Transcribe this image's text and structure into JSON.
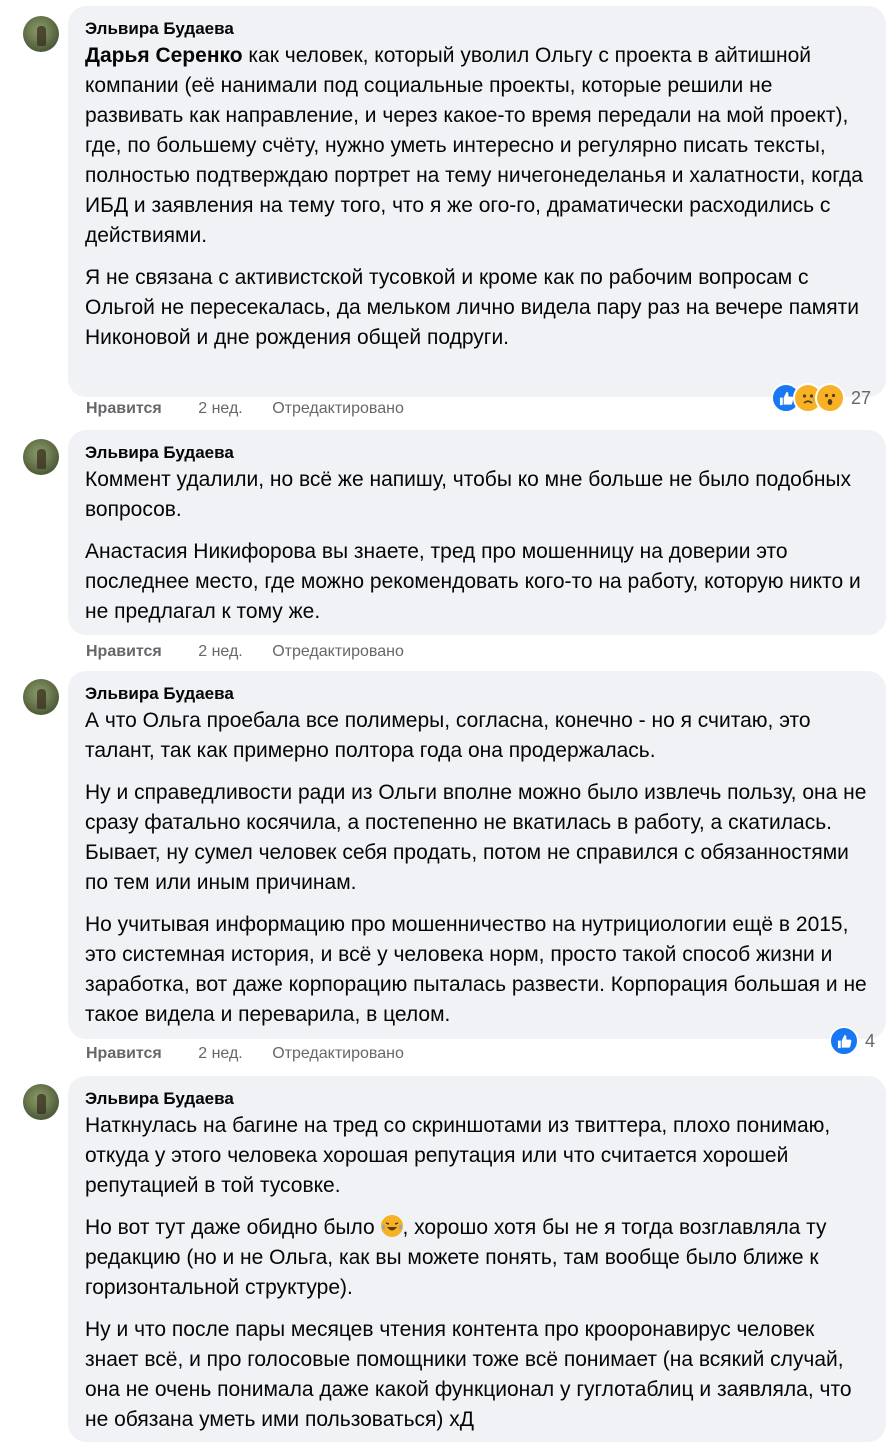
{
  "comments": [
    {
      "author": "Эльвира Будаева",
      "mention": "Дарья Серенко",
      "paragraphs": [
        " как человек, который уволил Ольгу с проекта в айтишной компании (её нанимали под социальные проекты, которые решили не развивать как направление, и через какое-то время передали на мой проект), где, по большему счёту, нужно уметь интересно и регулярно писать тексты, полностью подтверждаю портрет на тему ничегонеделанья и халатности, когда ИБД и заявления на тему того, что я же ого-го, драматически расходились с действиями.",
        "Я не связана с активистской тусовкой и кроме как по рабочим вопросам с Ольгой не пересекалась, да мельком лично видела пару раз на вечере памяти Никоновой и дне рождения общей подруги."
      ],
      "like_label": "Нравится",
      "time": "2 нед.",
      "edited": "Отредактировано",
      "reaction_icons": [
        "like-icon",
        "sad-icon",
        "wow-icon"
      ],
      "reaction_count": "27"
    },
    {
      "author": "Эльвира Будаева",
      "paragraphs": [
        "Коммент удалили, но всё же напишу, чтобы ко мне больше не было подобных вопросов.",
        "Анастасия Никифорова вы знаете, тред про мошенницу на доверии это последнее место, где можно рекомендовать кого-то на работу, которую никто и не предлагал к тому же."
      ],
      "like_label": "Нравится",
      "time": "2 нед.",
      "edited": "Отредактировано"
    },
    {
      "author": "Эльвира Будаева",
      "paragraphs": [
        "А что Ольга проебала все полимеры, согласна, конечно - но я считаю, это талант, так как примерно полтора года она продержалась.",
        "Ну и справедливости ради из Ольги вполне можно было извлечь пользу, она не сразу фатально косячила, а постепенно не вкатилась в работу, а скатилась. Бывает, ну сумел человек себя продать, потом не справился с обязанностями по тем или иным причинам.",
        "Но учитывая информацию про мошенничество на нутрициологии ещё в 2015, это системная история, и всё у человека норм, просто такой способ жизни и заработка, вот даже корпорацию пыталась развести. Корпорация большая и не такое видела и переварила, в целом."
      ],
      "like_label": "Нравится",
      "time": "2 нед.",
      "edited": "Отредактировано",
      "reaction_icons": [
        "like-icon"
      ],
      "reaction_count": "4"
    },
    {
      "author": "Эльвира Будаева",
      "paragraphs": [
        "Наткнулась на багине на тред со скриншотами из твиттера, плохо понимаю, откуда у этого человека хорошая репутация или что считается хорошей репутацией в той тусовке.",
        "",
        "Ну и что после пары месяцев чтения контента про крооронавирус человек знает всё, и про голосовые помощники тоже всё понимает (на всякий случай, она не очень понимала даже какой функционал у гуглотаблиц и заявляла, что не обязана уметь ими пользоваться) хД"
      ],
      "p2_before": "Но вот тут даже обидно было ",
      "p2_emoji": "rofl-emoji-icon",
      "p2_after": ", хорошо хотя бы не я тогда возглавляла ту редакцию (но и не Ольга, как вы можете понять, там вообще было ближе к горизонтальной структуре)."
    }
  ],
  "colors": {
    "bubble": "#f0f2f5",
    "meta_text": "#65676b",
    "like_blue": "#1877f2",
    "emoji_yellow": "#f7b125"
  }
}
